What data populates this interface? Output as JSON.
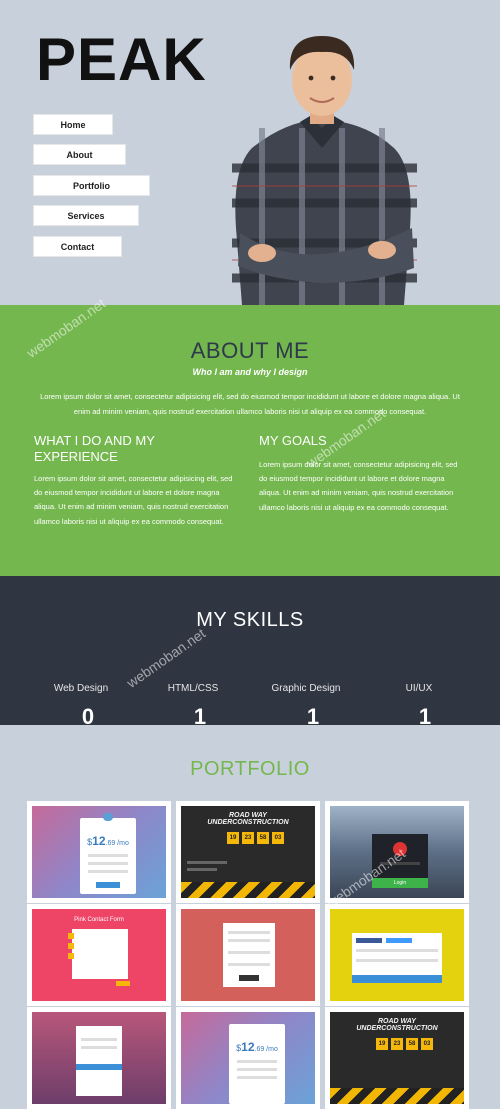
{
  "brand": {
    "logo": "PEAK"
  },
  "nav": {
    "items": [
      {
        "label": "Home"
      },
      {
        "label": "About"
      },
      {
        "label": "Portfolio"
      },
      {
        "label": "Services"
      },
      {
        "label": "Contact"
      }
    ]
  },
  "about": {
    "title": "ABOUT ME",
    "subtitle": "Who I am and why I design",
    "intro": "Lorem ipsum dolor sit amet, consectetur adipisicing elit, sed do eiusmod tempor incididunt ut labore et dolore magna aliqua. Ut enim ad minim veniam, quis nostrud exercitation ullamco laboris nisi ut aliquip ex ea commodo consequat.",
    "left": {
      "title": "WHAT I DO AND MY EXPERIENCE",
      "text": "Lorem ipsum dolor sit amet, consectetur adipisicing elit, sed do eiusmod tempor incididunt ut labore et dolore magna aliqua. Ut enim ad minim veniam, quis nostrud exercitation ullamco laboris nisi ut aliquip ex ea commodo consequat."
    },
    "right": {
      "title": "MY GOALS",
      "text": "Lorem ipsum dolor sit amet, consectetur adipisicing elit, sed do eiusmod tempor incididunt ut labore et dolore magna aliqua. Ut enim ad minim veniam, quis nostrud exercitation ullamco laboris nisi ut aliquip ex ea commodo consequat."
    }
  },
  "skills": {
    "title": "MY SKILLS",
    "items": [
      {
        "label": "Web Design",
        "value": "0"
      },
      {
        "label": "HTML/CSS",
        "value": "1"
      },
      {
        "label": "Graphic Design",
        "value": "1"
      },
      {
        "label": "UI/UX",
        "value": "1"
      }
    ]
  },
  "portfolio": {
    "title": "PORTFOLIO",
    "thumbs": [
      {
        "price": "$12.69 /mo",
        "price_big": "12",
        "price_rest": ".69 /mo"
      },
      {
        "banner": "ROAD WAY UNDERCONSTRUCTION",
        "counters": [
          "19",
          "23",
          "58",
          "03"
        ]
      },
      {
        "button": "Login"
      },
      {
        "heading": "Pink Contact Form"
      },
      {
        "heading": ""
      },
      {
        "heading": ""
      },
      {
        "heading": ""
      },
      {
        "price": "$12.69 /mo",
        "price_big": "12",
        "price_rest": ".69 /mo"
      },
      {
        "banner": "ROAD WAY UNDERCONSTRUCTION",
        "counters": [
          "19",
          "23",
          "58",
          "03"
        ]
      }
    ]
  },
  "watermark": "webmoban.net",
  "colors": {
    "green": "#74b74e",
    "dark": "#2f3541",
    "hero_bg": "#c8d0dc",
    "navy": "#2e3a4a"
  }
}
